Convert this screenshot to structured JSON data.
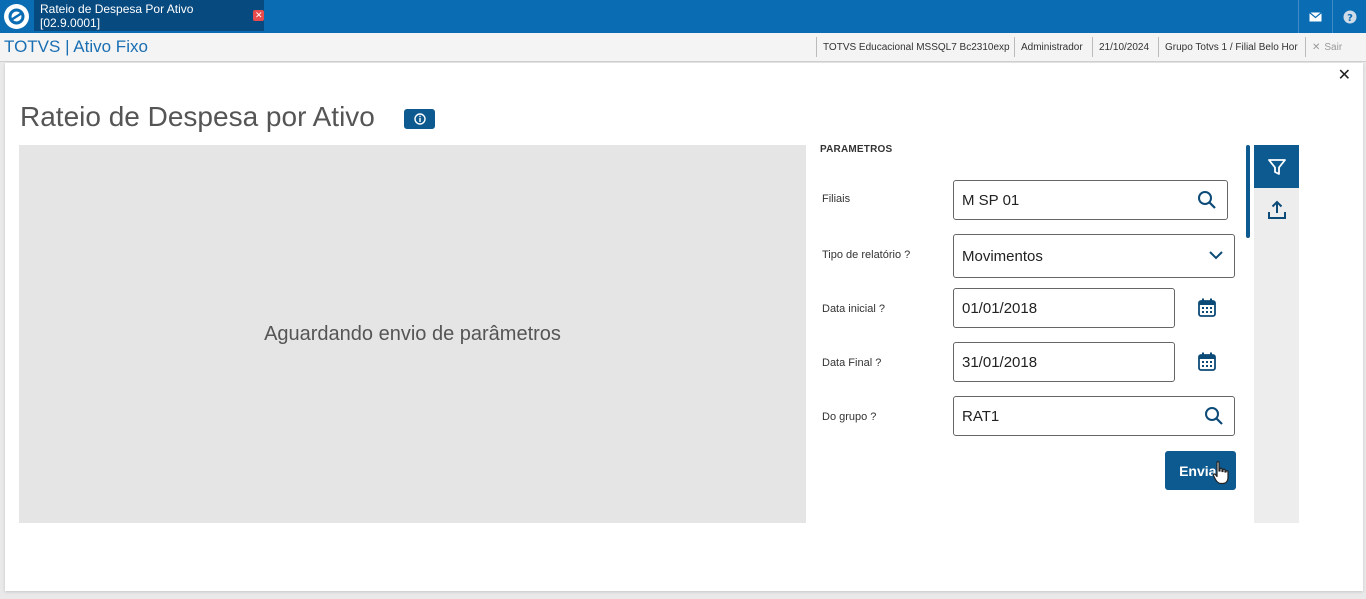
{
  "topbar": {
    "tab_title": "Rateio de Despesa Por Ativo [02.9.0001]"
  },
  "subbar": {
    "brand": "TOTVS | Ativo Fixo",
    "environment": "TOTVS Educacional MSSQL7 Bc2310exp",
    "user": "Administrador",
    "date": "21/10/2024",
    "company": "Grupo Totvs 1 / Filial Belo Hor",
    "exit_label": "Sair"
  },
  "page": {
    "title": "Rateio de Despesa por Ativo",
    "preview_message": "Aguardando envio de parâmetros"
  },
  "params": {
    "section_title": "PARAMETROS",
    "filiais": {
      "label": "Filiais",
      "value": "M SP 01"
    },
    "tipo_relatorio": {
      "label": "Tipo de relatório ?",
      "value": "Movimentos"
    },
    "data_inicial": {
      "label": "Data inicial ?",
      "value": "01/01/2018"
    },
    "data_final": {
      "label": "Data Final ?",
      "value": "31/01/2018"
    },
    "do_grupo": {
      "label": "Do grupo ?",
      "value": "RAT1"
    },
    "send_label": "Enviar"
  },
  "colors": {
    "topbar": "#0a6cb3",
    "primary": "#0c5a8f",
    "preview_bg": "#e5e5e5"
  },
  "icons": [
    "totvs-logo-icon",
    "tab-close-icon",
    "mail-icon",
    "help-icon",
    "close-icon",
    "info-icon",
    "search-icon",
    "chevron-down-icon",
    "calendar-icon",
    "filter-icon",
    "upload-icon",
    "cursor-hand-icon"
  ]
}
